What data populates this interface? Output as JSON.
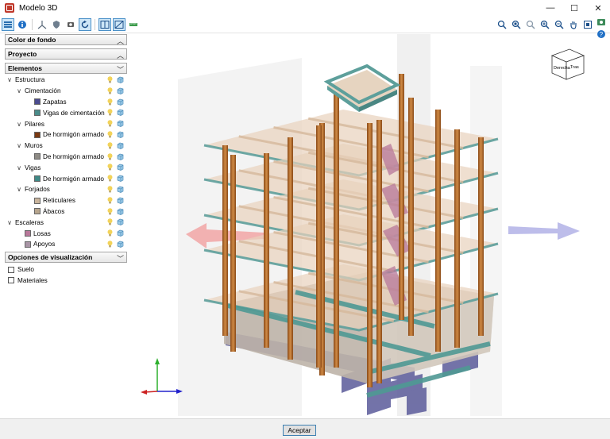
{
  "window": {
    "title": "Modelo 3D",
    "minimize": "—",
    "maximize": "☐",
    "close": "✕"
  },
  "panel": {
    "sections": {
      "background": "Color de fondo",
      "project": "Proyecto",
      "elements": "Elementos",
      "view_options": "Opciones de visualización"
    },
    "tree": [
      {
        "label": "Estructura",
        "level": 0,
        "expanded": true
      },
      {
        "label": "Cimentación",
        "level": 1,
        "expanded": true
      },
      {
        "label": "Zapatas",
        "level": 2,
        "color": "#4b4b8f"
      },
      {
        "label": "Vigas de cimentación",
        "level": 2,
        "color": "#4a8c8a"
      },
      {
        "label": "Pilares",
        "level": 1,
        "expanded": true
      },
      {
        "label": "De hormigón armado",
        "level": 2,
        "color": "#7a3a12"
      },
      {
        "label": "Muros",
        "level": 1,
        "expanded": true
      },
      {
        "label": "De hormigón armado",
        "level": 2,
        "color": "#8e8b85"
      },
      {
        "label": "Vigas",
        "level": 1,
        "expanded": true
      },
      {
        "label": "De hormigón armado",
        "level": 2,
        "color": "#3f8a87"
      },
      {
        "label": "Forjados",
        "level": 1,
        "expanded": true
      },
      {
        "label": "Reticulares",
        "level": 2,
        "color": "#c9b49c"
      },
      {
        "label": "Ábacos",
        "level": 2,
        "color": "#b7a58d"
      },
      {
        "label": "Escaleras",
        "level": 0,
        "expanded": true
      },
      {
        "label": "Losas",
        "level": 1,
        "color": "#b8789a"
      },
      {
        "label": "Apoyos",
        "level": 1,
        "color": "#a895a5"
      }
    ],
    "options": [
      {
        "label": "Suelo",
        "checked": false
      },
      {
        "label": "Materiales",
        "checked": false
      }
    ]
  },
  "viewcube": {
    "front": "Derecha",
    "right": "Tras"
  },
  "footer": {
    "accept": "Aceptar"
  },
  "colors": {
    "accent": "#4a90c8",
    "column": "#b5682a",
    "slab": "#e8d2bc",
    "beam": "#5d9f9b",
    "footing": "#5b5b9a",
    "arrow_x": "#f0a0a0",
    "arrow_y": "#a8a8e0"
  }
}
